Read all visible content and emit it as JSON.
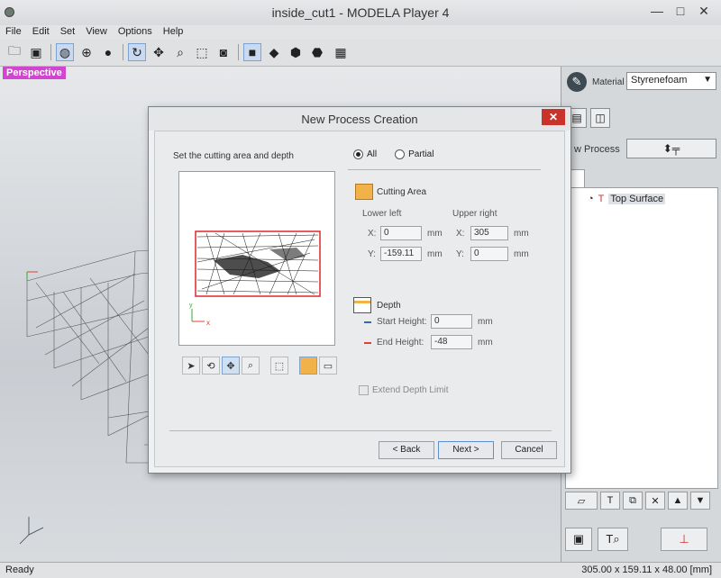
{
  "window": {
    "title": "inside_cut1 - MODELA Player 4",
    "minimize": "—",
    "maximize": "□",
    "close": "✕"
  },
  "menu": [
    "File",
    "Edit",
    "Set",
    "View",
    "Options",
    "Help"
  ],
  "viewport": {
    "mode_label": "Perspective"
  },
  "right_panel": {
    "material_label": "Material",
    "material_value": "Styrenefoam",
    "new_process_label": "w Process",
    "tree_items": [
      "Top Surface"
    ]
  },
  "status": {
    "left": "Ready",
    "right": "305.00 x 159.11 x 48.00 [mm]"
  },
  "dialog": {
    "title": "New Process Creation",
    "close": "✕",
    "caption": "Set the cutting area and depth",
    "radio_all": "All",
    "radio_partial": "Partial",
    "cutting_area": {
      "label": "Cutting Area",
      "lower_left": "Lower left",
      "upper_right": "Upper right",
      "x_label": "X:",
      "y_label": "Y:",
      "ll_x": "0",
      "ll_y": "-159.11",
      "ur_x": "305",
      "ur_y": "0",
      "unit": "mm"
    },
    "depth": {
      "label": "Depth",
      "start_label": "Start Height:",
      "start_value": "0",
      "end_label": "End Height:",
      "end_value": "-48",
      "unit": "mm"
    },
    "extend_depth": "Extend Depth Limit",
    "buttons": {
      "back": "< Back",
      "next": "Next >",
      "cancel": "Cancel"
    },
    "preview_axes": {
      "x": "x",
      "y": "y"
    }
  },
  "colors": {
    "accent_magenta": "#d245cf",
    "selection_red": "#e0272b",
    "area_orange": "#f2b24a"
  }
}
